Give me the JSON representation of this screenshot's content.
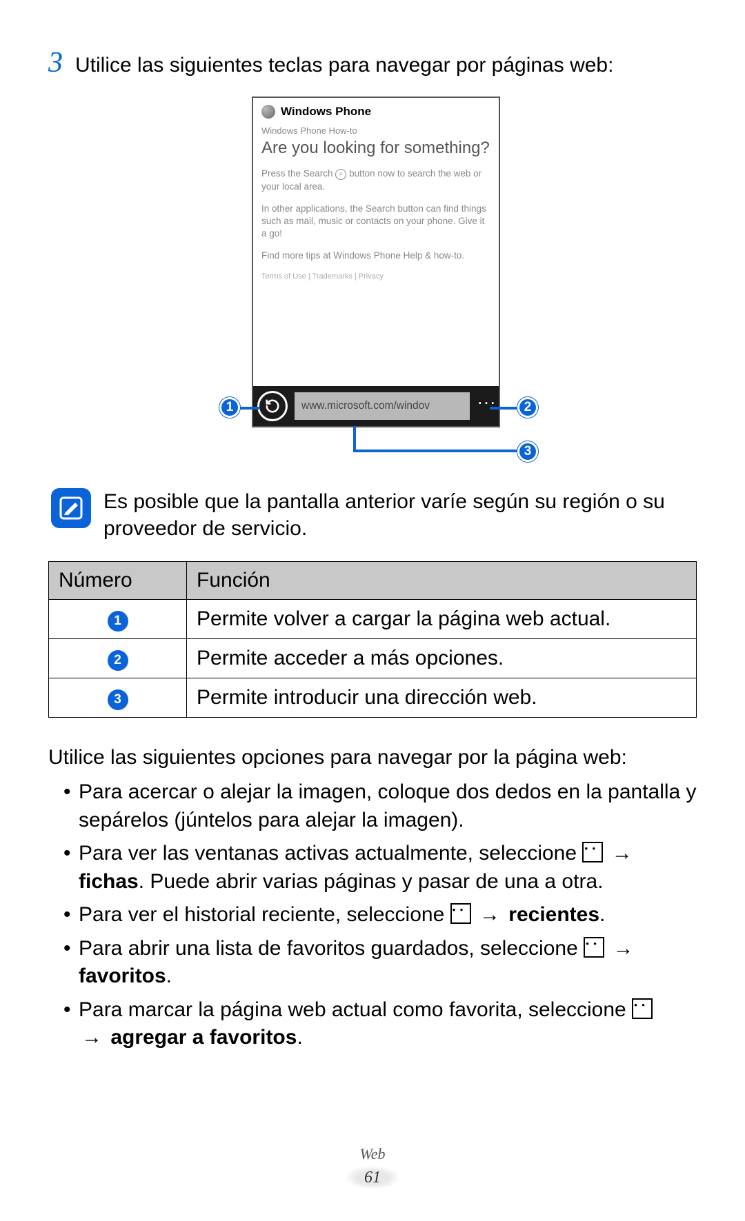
{
  "step": {
    "number": "3",
    "text": "Utilice las siguientes teclas para navegar por páginas web:"
  },
  "phone": {
    "brand": "Windows Phone",
    "subtitle": "Windows Phone How-to",
    "heading": "Are you looking for something?",
    "p1_a": "Press the Search ",
    "p1_b": " button now to search the web or your local area.",
    "search_glyph": "⌕",
    "p2": "In other applications, the Search button can find things such as mail, music or contacts on your phone. Give it a go!",
    "p3": "Find more tips at Windows Phone Help & how-to.",
    "legal": "Terms of Use | Trademarks | Privacy",
    "url": "www.microsoft.com/windov",
    "more_glyph": "..."
  },
  "callouts": {
    "c1": "1",
    "c2": "2",
    "c3": "3"
  },
  "note": "Es posible que la pantalla anterior varíe según su región o su proveedor de servicio.",
  "table": {
    "h_num": "Número",
    "h_func": "Función",
    "rows": [
      {
        "n": "1",
        "f": "Permite volver a cargar la página web actual."
      },
      {
        "n": "2",
        "f": "Permite acceder a más opciones."
      },
      {
        "n": "3",
        "f": "Permite introducir una dirección web."
      }
    ]
  },
  "options_intro": "Utilice las siguientes opciones para navegar por la página web:",
  "arrow": "→",
  "dots_glyph": "● ● ●",
  "bullets": {
    "b1": "Para acercar o alejar la imagen, coloque dos dedos en la pantalla y sepárelos (júntelos para alejar la imagen).",
    "b2_a": "Para ver las ventanas activas actualmente, seleccione ",
    "b2_bold": "fichas",
    "b2_c": ". Puede abrir varias páginas y pasar de una a otra.",
    "b3_a": "Para ver el historial reciente, seleccione ",
    "b3_bold": "recientes",
    "b3_c": ".",
    "b4_a": "Para abrir una lista de favoritos guardados, seleccione ",
    "b4_bold": "favoritos",
    "b4_c": ".",
    "b5_a": "Para marcar la página web actual como favorita, seleccione ",
    "b5_bold": "agregar a favoritos",
    "b5_c": "."
  },
  "footer": {
    "section": "Web",
    "page": "61"
  }
}
